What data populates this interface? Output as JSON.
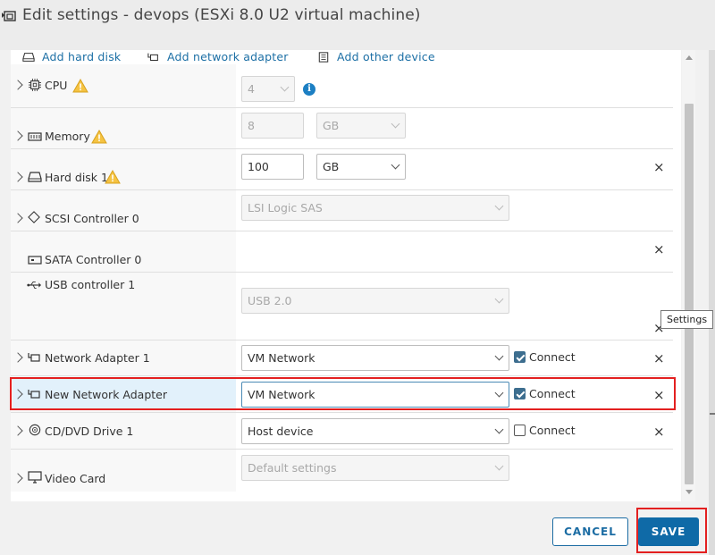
{
  "dialog": {
    "title": "Edit settings - devops (ESXi 8.0 U2 virtual machine)"
  },
  "add_bar": {
    "hard_disk": "Add hard disk",
    "network_adapter": "Add network adapter",
    "other_device": "Add other device"
  },
  "devices": {
    "cpu": {
      "label": "CPU",
      "value": "4",
      "warning": true
    },
    "memory": {
      "label": "Memory",
      "value": "8",
      "unit": "GB",
      "warning": true
    },
    "hard_disk": {
      "label": "Hard disk 1",
      "value": "100",
      "unit": "GB",
      "warning": true
    },
    "scsi": {
      "label": "SCSI Controller 0",
      "value": "LSI Logic SAS"
    },
    "sata": {
      "label": "SATA Controller 0"
    },
    "usb": {
      "label": "USB controller 1",
      "value": "USB 2.0"
    },
    "net1": {
      "label": "Network Adapter 1",
      "value": "VM Network",
      "connect_label": "Connect",
      "connected": true
    },
    "new_net": {
      "label": "New Network Adapter",
      "value": "VM Network",
      "connect_label": "Connect",
      "connected": true
    },
    "cdrom": {
      "label": "CD/DVD Drive 1",
      "value": "Host device",
      "connect_label": "Connect",
      "connected": false
    },
    "video": {
      "label": "Video Card",
      "value": "Default settings"
    }
  },
  "tooltip": "Settings",
  "footer": {
    "cancel": "CANCEL",
    "save": "SAVE"
  },
  "icons": {
    "close": "×",
    "info": "i",
    "warning": "warning-icon"
  },
  "colors": {
    "accent": "#0f6aa7",
    "highlight": "#e32020",
    "warning": "#f0b323"
  }
}
